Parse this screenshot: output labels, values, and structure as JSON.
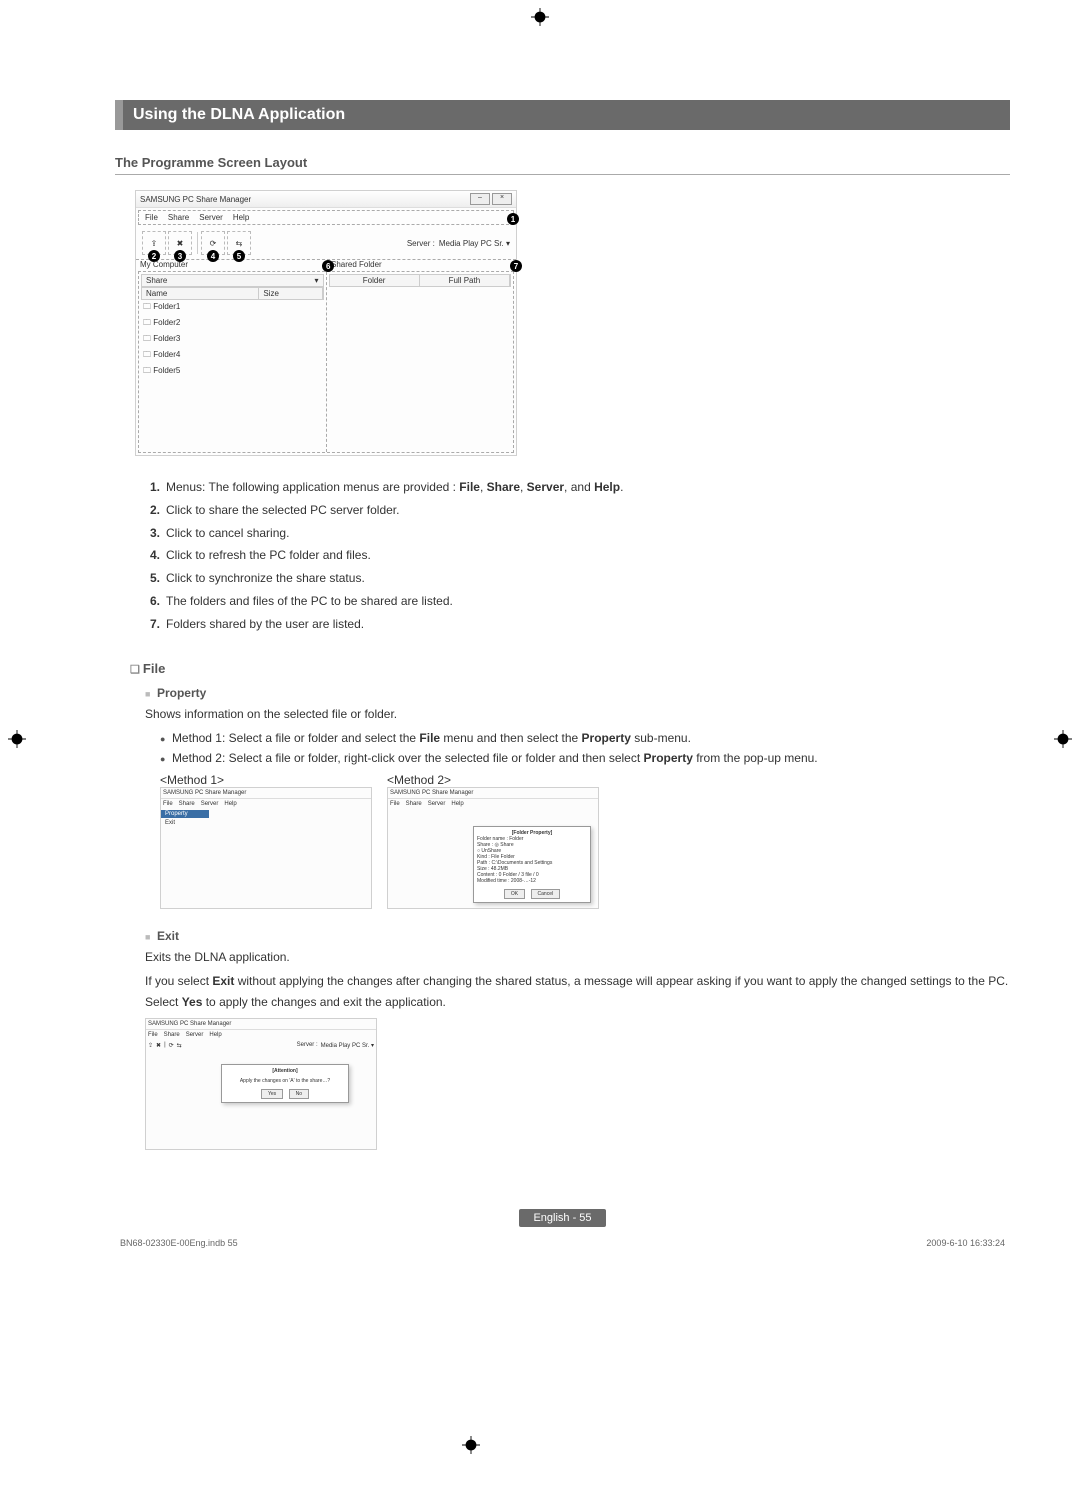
{
  "section_title": "Using the DLNA Application",
  "subheading": "The Programme Screen Layout",
  "main_screenshot": {
    "app_title": "SAMSUNG PC Share Manager",
    "menus": [
      "File",
      "Share",
      "Server",
      "Help"
    ],
    "server_label": "Server :",
    "server_value": "Media Play PC Sr.  ▾",
    "left_pane_title": "My Computer",
    "left_folder_value": "Share",
    "left_columns": [
      "Name",
      "Size"
    ],
    "left_folders": [
      "Folder1",
      "Folder2",
      "Folder3",
      "Folder4",
      "Folder5"
    ],
    "right_pane_title": "Shared Folder",
    "right_columns": [
      "Folder",
      "Full Path"
    ],
    "badges": [
      "1",
      "2",
      "3",
      "4",
      "5",
      "6",
      "7"
    ]
  },
  "numbered": [
    {
      "n": "1.",
      "t": "Menus: The following application menus are provided : ",
      "b": [
        "File",
        "Share",
        "Server",
        "Help"
      ],
      "tail": "."
    },
    {
      "n": "2.",
      "t": "Click to share the selected PC server folder."
    },
    {
      "n": "3.",
      "t": "Click to cancel sharing."
    },
    {
      "n": "4.",
      "t": "Click to refresh the PC folder and files."
    },
    {
      "n": "5.",
      "t": "Click to synchronize the share status."
    },
    {
      "n": "6.",
      "t": "The folders and files of the PC to be shared are listed."
    },
    {
      "n": "7.",
      "t": "Folders shared by the user are listed."
    }
  ],
  "file_heading": "File",
  "property": {
    "title": "Property",
    "desc": "Shows information on the selected file or folder.",
    "m1_line": "Method 1: Select a file or folder and select the ",
    "m1_bold1": "File",
    "m1_mid": " menu and then select the ",
    "m1_bold2": "Property",
    "m1_end": " sub-menu.",
    "m2_line": "Method 2: Select a file or folder, right-click over the selected file or folder and then select ",
    "m2_bold": "Property",
    "m2_end": " from the pop-up menu.",
    "method1_label": "<Method 1>",
    "method2_label": "<Method 2>"
  },
  "method2_dialog": {
    "title": "[Folder Property]",
    "lines": [
      "Folder name : Folder",
      "Share :      ◎ Share",
      "             ○ UnShare",
      "Kind : File Folder",
      "Path : C:\\Documents and Settings",
      "Size : 48.2MB",
      "Content : 0 Folder / 3 file / 0",
      "Modified time : 2008-…-12"
    ],
    "ok": "OK",
    "cancel": "Cancel"
  },
  "exit": {
    "title": "Exit",
    "line1": "Exits the DLNA application.",
    "line2a": "If you select ",
    "line2b": "Exit",
    "line2c": " without applying the changes after changing the shared status, a message will appear asking if you want to apply the changed settings to the PC. Select ",
    "line2d": "Yes",
    "line2e": " to apply the changes and exit the application."
  },
  "exit_dialog": {
    "title": "[Attention]",
    "msg": "Apply the changes on 'A' to the share…?",
    "yes": "Yes",
    "no": "No"
  },
  "footer_page": "English - 55",
  "doc_code": "BN68-02330E-00Eng.indb   55",
  "doc_time": "2009-6-10   16:33:24"
}
